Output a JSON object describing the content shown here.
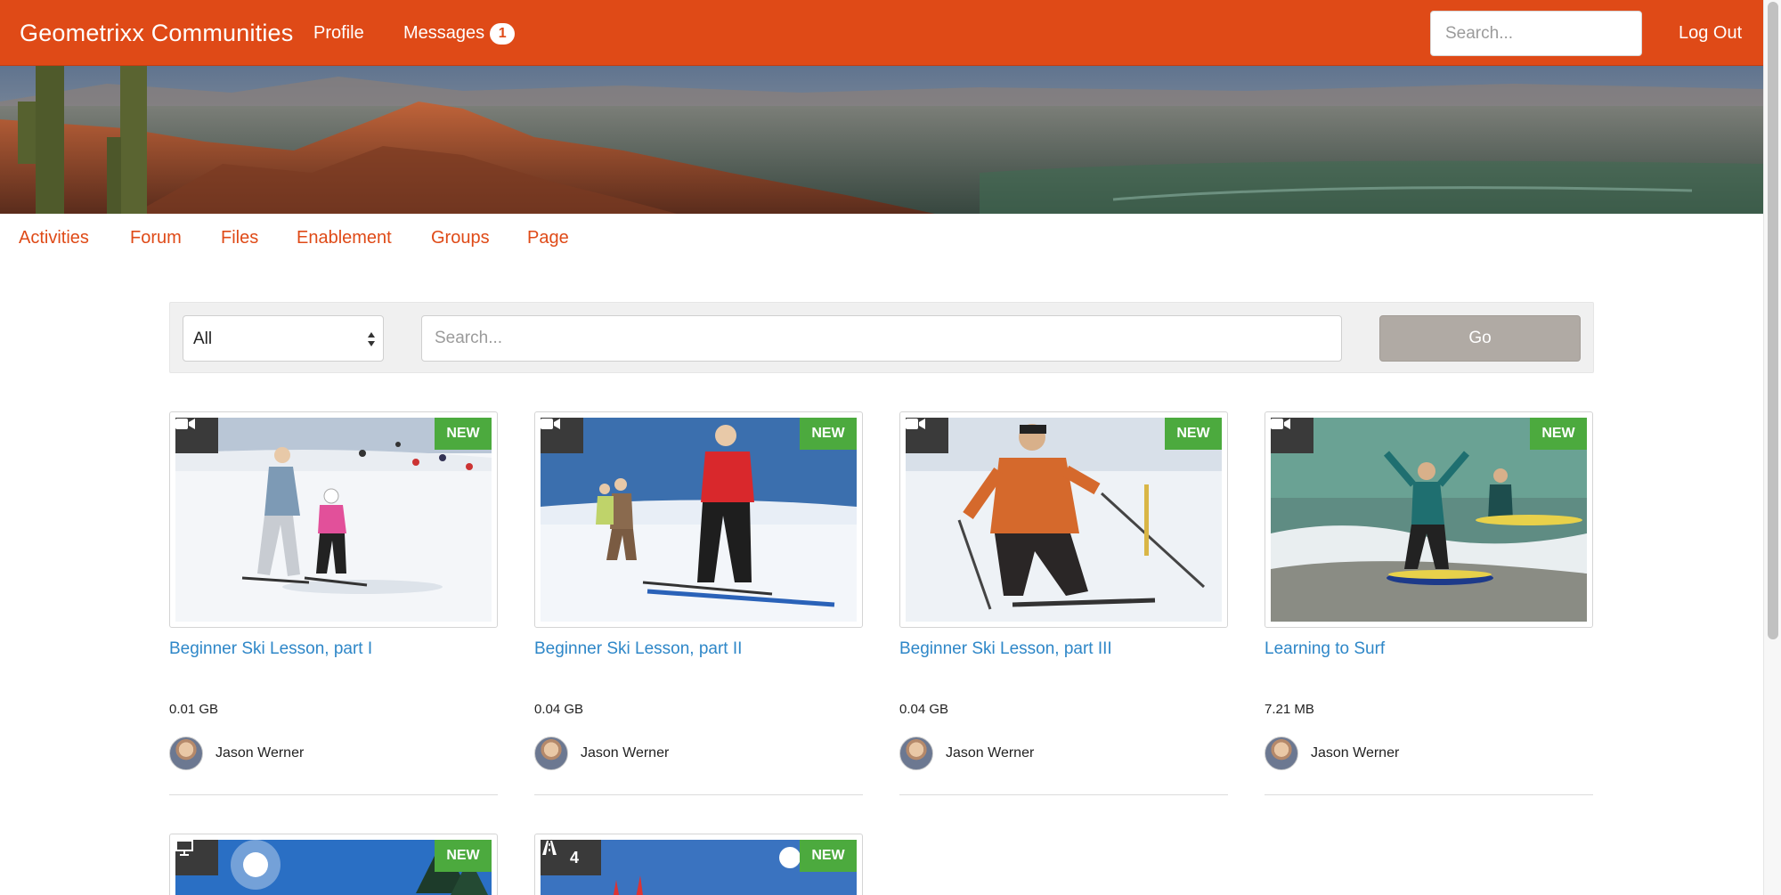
{
  "header": {
    "brand": "Geometrixx Communities",
    "nav": [
      {
        "label": "Profile"
      },
      {
        "label": "Messages",
        "badge": "1"
      }
    ],
    "search_placeholder": "Search...",
    "logout_label": "Log Out",
    "brand_color": "#df4a17"
  },
  "community_nav": [
    {
      "label": "Activities"
    },
    {
      "label": "Forum"
    },
    {
      "label": "Files"
    },
    {
      "label": "Enablement"
    },
    {
      "label": "Groups"
    },
    {
      "label": "Page"
    }
  ],
  "filter": {
    "selected": "All",
    "search_placeholder": "Search...",
    "go_label": "Go"
  },
  "cards": [
    {
      "title": "Beginner Ski Lesson, part I",
      "size": "0.01 GB",
      "author": "Jason Werner",
      "badge": "NEW",
      "type_icon": "video-camera-icon"
    },
    {
      "title": "Beginner Ski Lesson, part II",
      "size": "0.04 GB",
      "author": "Jason Werner",
      "badge": "NEW",
      "type_icon": "video-camera-icon"
    },
    {
      "title": "Beginner Ski Lesson, part III",
      "size": "0.04 GB",
      "author": "Jason Werner",
      "badge": "NEW",
      "type_icon": "video-camera-icon"
    },
    {
      "title": "Learning to Surf",
      "size": "7.21 MB",
      "author": "Jason Werner",
      "badge": "NEW",
      "type_icon": "video-camera-icon"
    },
    {
      "badge": "NEW",
      "type_icon": "presentation-icon"
    },
    {
      "badge": "NEW",
      "type_icon": "learning-path-icon",
      "count": "4"
    }
  ],
  "colors": {
    "link": "#2e87c8",
    "new_badge": "#4caa3e",
    "go_button": "#b0aaa4"
  }
}
